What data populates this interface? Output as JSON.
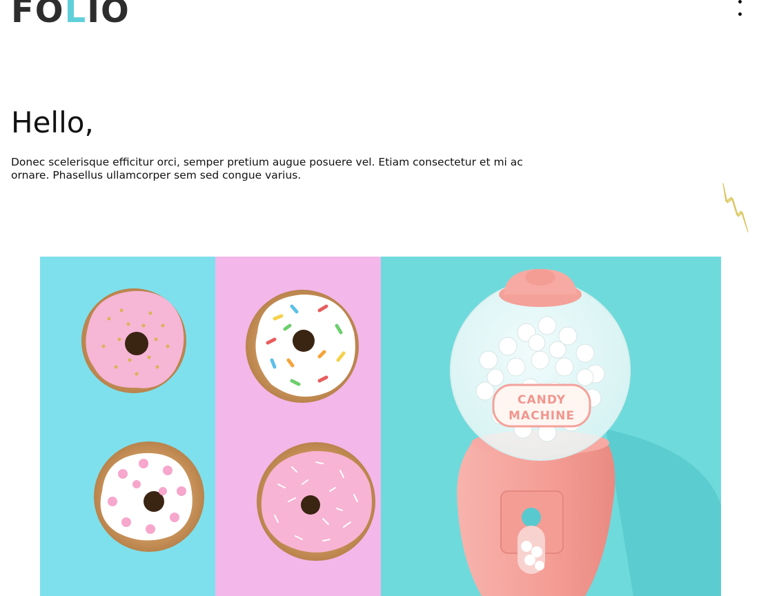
{
  "header": {
    "logo": {
      "text_before": "FO",
      "text_accent": "L",
      "text_after": "IO",
      "trademark": "™",
      "color": "#2d2d2d",
      "accent_color": "#5fd0da"
    },
    "menu_icon": "more-vertical-icon"
  },
  "hero": {
    "heading": "Hello,",
    "body": "Donec scelerisque efficitur orci, semper pretium augue posuere vel. Etiam consectetur et mi ac ornare. Phasellus ullamcorper sem sed congue varius."
  },
  "decoration": {
    "icon": "lightning-bolt-icon",
    "color": "#e6d36b"
  },
  "feature_image": {
    "machine_label_line1": "CANDY",
    "machine_label_line2": "MACHINE",
    "colors": {
      "blue": "#7ee0ec",
      "pink": "#f3b7ea",
      "teal": "#6fdadb",
      "machine": "#f4a19a"
    }
  }
}
